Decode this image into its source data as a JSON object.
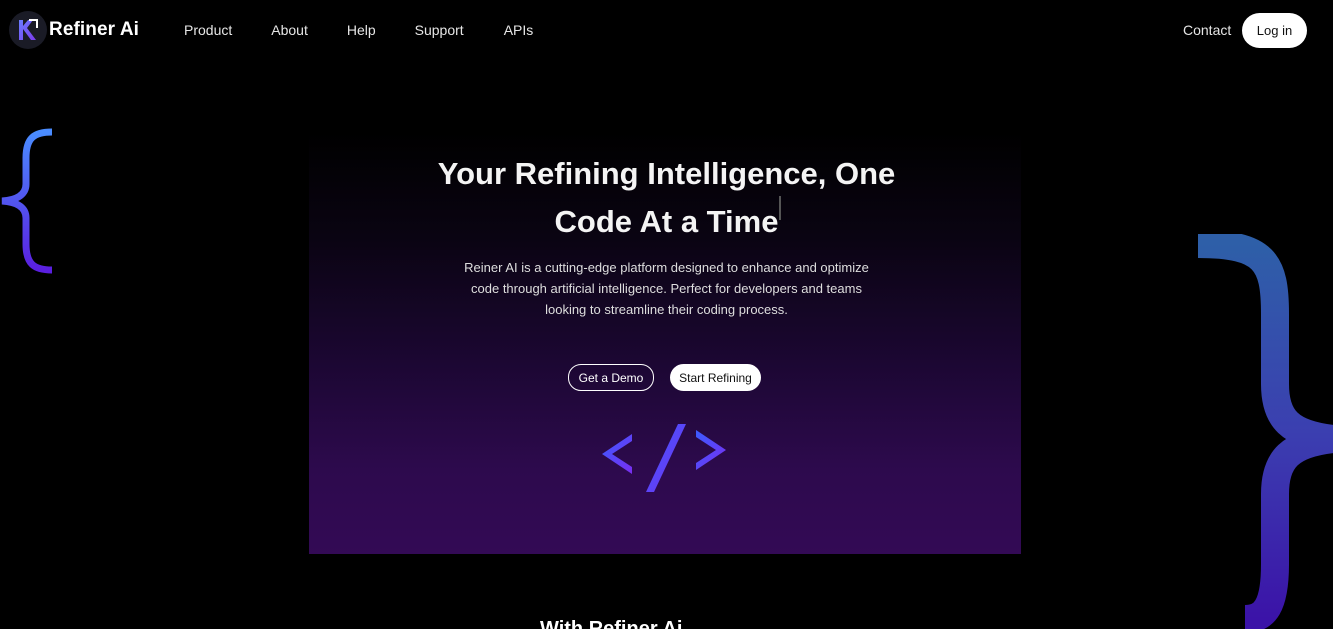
{
  "brand": {
    "name": "Refiner Ai",
    "logo_icon": "refiner-logo-icon"
  },
  "nav": {
    "links": [
      "Product",
      "About",
      "Help",
      "Support",
      "APIs"
    ],
    "contact": "Contact",
    "login": "Log in"
  },
  "hero": {
    "title": "Your Refining Intelligence, One Code At a Time",
    "description": "Reiner AI is a cutting-edge platform designed to enhance and optimize code through artificial intelligence. Perfect for developers and teams looking to streamline their coding process.",
    "demo_button": "Get a Demo",
    "start_button": "Start Refining",
    "code_icon": "code-tag-icon"
  },
  "next_section": {
    "title_partial": "With Refiner Ai"
  },
  "colors": {
    "background": "#000000",
    "accent_purple": "#5b2ee6",
    "accent_blue": "#4a7dff",
    "panel_bottom": "#330a55"
  }
}
